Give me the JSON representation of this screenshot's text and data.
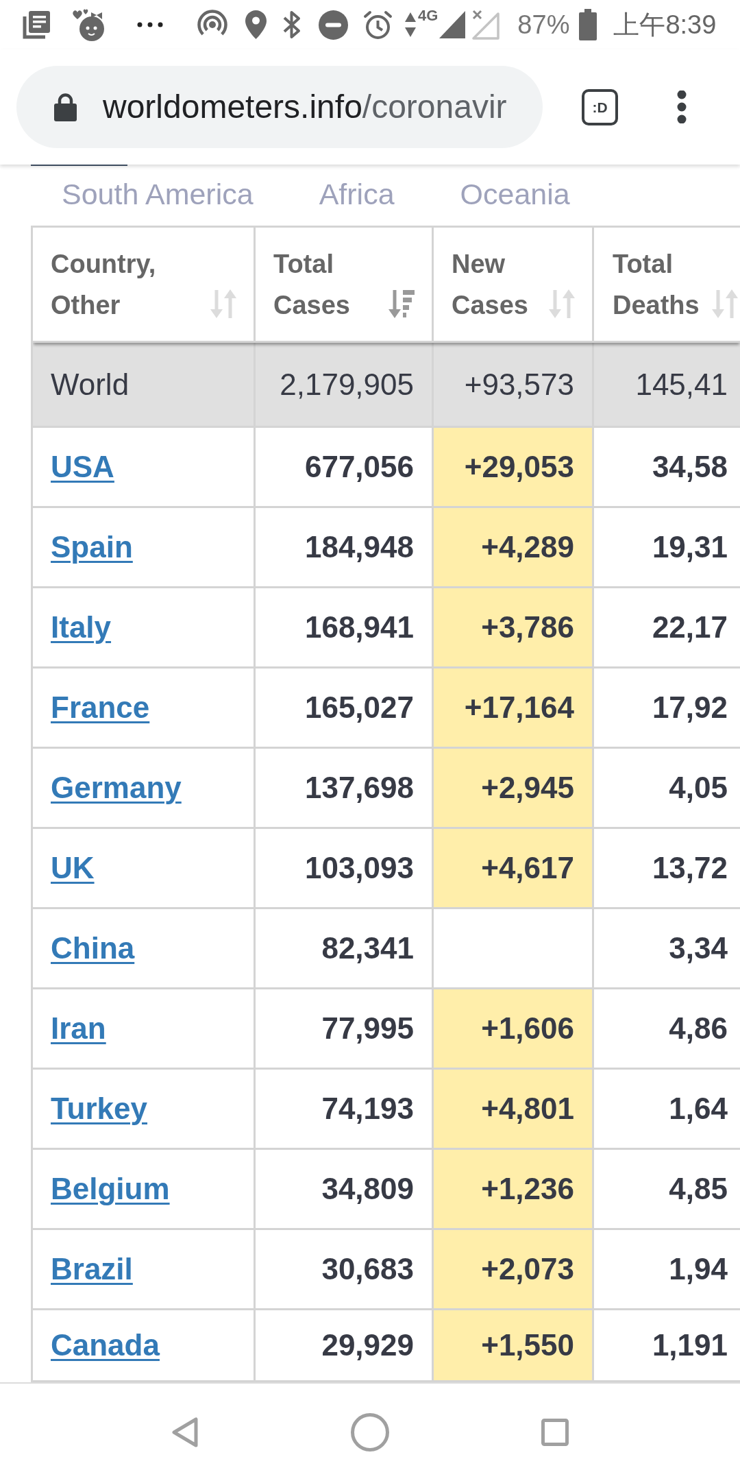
{
  "status_bar": {
    "network": "4G",
    "battery": "87%",
    "time": "上午8:39"
  },
  "browser": {
    "url_host": "worldometers.info",
    "url_path": "/coronavir",
    "tab_count": ":D"
  },
  "region_tabs": [
    {
      "label": "South America",
      "selected": false
    },
    {
      "label": "Africa",
      "selected": false
    },
    {
      "label": "Oceania",
      "selected": false
    }
  ],
  "table": {
    "columns": [
      {
        "label": "Country, Other",
        "sorted": false
      },
      {
        "label": "Total Cases",
        "sorted": true
      },
      {
        "label": "New Cases",
        "sorted": false
      },
      {
        "label": "Total Deaths",
        "sorted": false
      }
    ],
    "rows": [
      {
        "kind": "total",
        "country": "World",
        "total_cases": "2,179,905",
        "new_cases": "+93,573",
        "total_deaths": "145,41"
      },
      {
        "kind": "country",
        "country": "USA",
        "total_cases": "677,056",
        "new_cases": "+29,053",
        "total_deaths": "34,58"
      },
      {
        "kind": "country",
        "country": "Spain",
        "total_cases": "184,948",
        "new_cases": "+4,289",
        "total_deaths": "19,31"
      },
      {
        "kind": "country",
        "country": "Italy",
        "total_cases": "168,941",
        "new_cases": "+3,786",
        "total_deaths": "22,17"
      },
      {
        "kind": "country",
        "country": "France",
        "total_cases": "165,027",
        "new_cases": "+17,164",
        "total_deaths": "17,92"
      },
      {
        "kind": "country",
        "country": "Germany",
        "total_cases": "137,698",
        "new_cases": "+2,945",
        "total_deaths": "4,05"
      },
      {
        "kind": "country",
        "country": "UK",
        "total_cases": "103,093",
        "new_cases": "+4,617",
        "total_deaths": "13,72"
      },
      {
        "kind": "country",
        "country": "China",
        "total_cases": "82,341",
        "total_deaths": "3,34"
      },
      {
        "kind": "country",
        "country": "Iran",
        "total_cases": "77,995",
        "new_cases": "+1,606",
        "total_deaths": "4,86"
      },
      {
        "kind": "country",
        "country": "Turkey",
        "total_cases": "74,193",
        "new_cases": "+4,801",
        "total_deaths": "1,64"
      },
      {
        "kind": "country",
        "country": "Belgium",
        "total_cases": "34,809",
        "new_cases": "+1,236",
        "total_deaths": "4,85"
      },
      {
        "kind": "country",
        "country": "Brazil",
        "total_cases": "30,683",
        "new_cases": "+2,073",
        "total_deaths": "1,94"
      },
      {
        "kind": "country",
        "country": "Canada",
        "total_cases": "29,929",
        "new_cases": "+1,550",
        "total_deaths": "1,191"
      }
    ]
  }
}
